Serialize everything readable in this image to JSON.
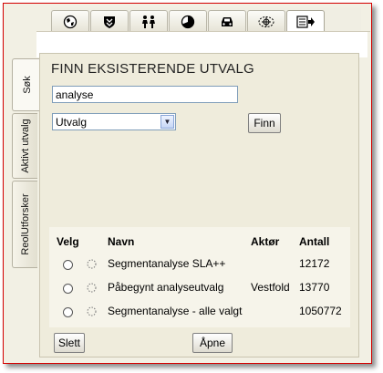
{
  "toolbar": {
    "icons": [
      "globe-icon",
      "shield-icon",
      "people-icon",
      "pie-chart-icon",
      "car-icon",
      "map-target-icon",
      "export-icon"
    ],
    "active_index": 6
  },
  "sidetabs": [
    {
      "label": "Søk",
      "active": true
    },
    {
      "label": "Aktivt utvalg",
      "active": false
    },
    {
      "label": "ReolUtforsker",
      "active": false
    }
  ],
  "panel": {
    "title": "FINN EKSISTERENDE UTVALG",
    "search_value": "analyse",
    "select_value": "Utvalg",
    "find_label": "Finn"
  },
  "table": {
    "headers": {
      "velg": "Velg",
      "navn": "Navn",
      "aktor": "Aktør",
      "antall": "Antall"
    },
    "rows": [
      {
        "navn": "Segmentanalyse SLA++",
        "aktor": "",
        "antall": "12172"
      },
      {
        "navn": "Påbegynt analyseutvalg",
        "aktor": "Vestfold",
        "antall": "13770"
      },
      {
        "navn": "Segmentanalyse - alle valgt",
        "aktor": "",
        "antall": "1050772"
      }
    ]
  },
  "actions": {
    "delete_label": "Slett",
    "open_label": "Åpne"
  },
  "colors": {
    "frame": "#d40000",
    "panel": "#efecdc"
  }
}
